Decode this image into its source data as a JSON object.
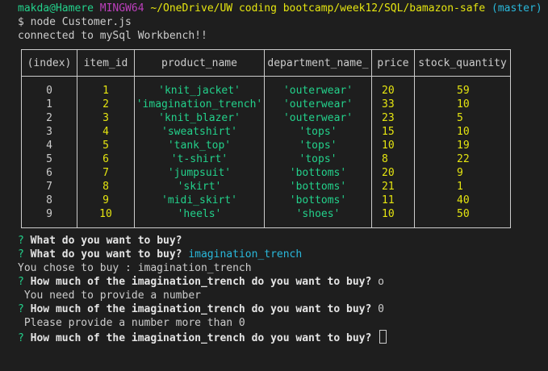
{
  "prompt": {
    "user_host": "makda@Hamere",
    "shell": "MINGW64",
    "path": "~/OneDrive/UW coding bootcamp/week12/SQL/bamazon-safe",
    "branch": "(master)"
  },
  "command": "$ node Customer.js",
  "status": "connected to mySql Workbench!!",
  "table": {
    "headers": [
      "(index)",
      "item_id",
      "product_name",
      "department_name_",
      "price",
      "stock_quantity"
    ],
    "rows": [
      {
        "index": "0",
        "item_id": "1",
        "product_name": "'knit_jacket'",
        "department": "'outerwear'",
        "price": "20",
        "stock": "59"
      },
      {
        "index": "1",
        "item_id": "2",
        "product_name": "'imagination_trench'",
        "department": "'outerwear'",
        "price": "33",
        "stock": "10"
      },
      {
        "index": "2",
        "item_id": "3",
        "product_name": "'knit_blazer'",
        "department": "'outerwear'",
        "price": "23",
        "stock": "5"
      },
      {
        "index": "3",
        "item_id": "4",
        "product_name": "'sweatshirt'",
        "department": "'tops'",
        "price": "15",
        "stock": "10"
      },
      {
        "index": "4",
        "item_id": "5",
        "product_name": "'tank_top'",
        "department": "'tops'",
        "price": "10",
        "stock": "19"
      },
      {
        "index": "5",
        "item_id": "6",
        "product_name": "'t-shirt'",
        "department": "'tops'",
        "price": "8",
        "stock": "22"
      },
      {
        "index": "6",
        "item_id": "7",
        "product_name": "'jumpsuit'",
        "department": "'bottoms'",
        "price": "20",
        "stock": "9"
      },
      {
        "index": "7",
        "item_id": "8",
        "product_name": "'skirt'",
        "department": "'bottoms'",
        "price": "21",
        "stock": "1"
      },
      {
        "index": "8",
        "item_id": "9",
        "product_name": "'midi_skirt'",
        "department": "'bottoms'",
        "price": "11",
        "stock": "40"
      },
      {
        "index": "9",
        "item_id": "10",
        "product_name": "'heels'",
        "department": "'shoes'",
        "price": "10",
        "stock": "50"
      }
    ]
  },
  "dialog": {
    "q_mark": "?",
    "q1": "What do you want to buy?",
    "q2": "What do you want to buy?",
    "a2": "imagination_trench",
    "chose": "You chose to buy : imagination_trench",
    "q3": "How much of the imagination_trench do you want to buy?",
    "a3": "o",
    "err1": " You need to provide a number",
    "q4": "How much of the imagination_trench do you want to buy?",
    "a4": "0",
    "err2": " Please provide a number more than 0",
    "q5": "How much of the imagination_trench do you want to buy?"
  },
  "colors": {
    "background": "#1e1e1e",
    "green": "#23d18b",
    "magenta": "#bc3fbc",
    "yellow": "#e5e510",
    "cyan": "#29b8db"
  }
}
